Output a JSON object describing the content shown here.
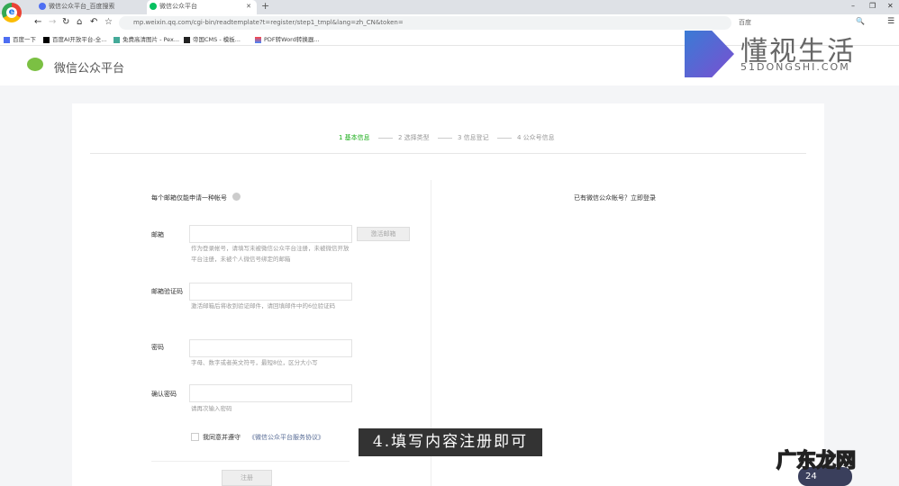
{
  "browser": {
    "tabs": [
      {
        "label": "微信公众平台_百度搜索"
      },
      {
        "label": "微信公众平台"
      }
    ],
    "new_tab": "+",
    "url": "mp.weixin.qq.com/cgi-bin/readtemplate?t=register/step1_tmpl&lang=zh_CN&token=",
    "search_label": "百度",
    "bookmarks": [
      {
        "label": "百度一下"
      },
      {
        "label": "百度AI开放平台-全..."
      },
      {
        "label": "免费高清图片 - Pex..."
      },
      {
        "label": "帝国CMS - 模板..."
      },
      {
        "label": "PDF转Word转换器..."
      }
    ],
    "window": {
      "minimize": "–",
      "restore": "❐",
      "close": "✕"
    }
  },
  "header": {
    "logo_text": "微信公众平台"
  },
  "steps": [
    {
      "label": "1 基本信息",
      "active": true
    },
    {
      "label": "2 选择类型"
    },
    {
      "label": "3 信息登记"
    },
    {
      "label": "4 公众号信息"
    }
  ],
  "form": {
    "notice": "每个邮箱仅能申请一种帐号",
    "email": {
      "label": "邮箱",
      "button": "激活邮箱",
      "tip": "作为登录帐号，请填写未被微信公众平台注册，未被微信开放平台注册，未被个人微信号绑定的邮箱"
    },
    "code": {
      "label": "邮箱验证码",
      "tip": "激活邮箱后将收到验证邮件，请回填邮件中的6位验证码"
    },
    "password": {
      "label": "密码",
      "tip": "字母、数字或者英文符号，最短8位，区分大小写"
    },
    "confirm": {
      "label": "确认密码",
      "tip": "请再次输入密码"
    },
    "agree_prefix": "我同意并遵守",
    "agree_link": "《微信公众平台服务协议》",
    "submit": "注册"
  },
  "side": {
    "login_hint": "已有微信公众帐号？立即登录"
  },
  "caption": "4.填写内容注册即可",
  "watermarks": {
    "brand": "懂视生活",
    "brand_sub": "51DONGSHI.COM",
    "corner": "广东龙网",
    "badge": "24"
  },
  "colors": {
    "accent": "#07c160",
    "step_active": "#1aad19"
  }
}
